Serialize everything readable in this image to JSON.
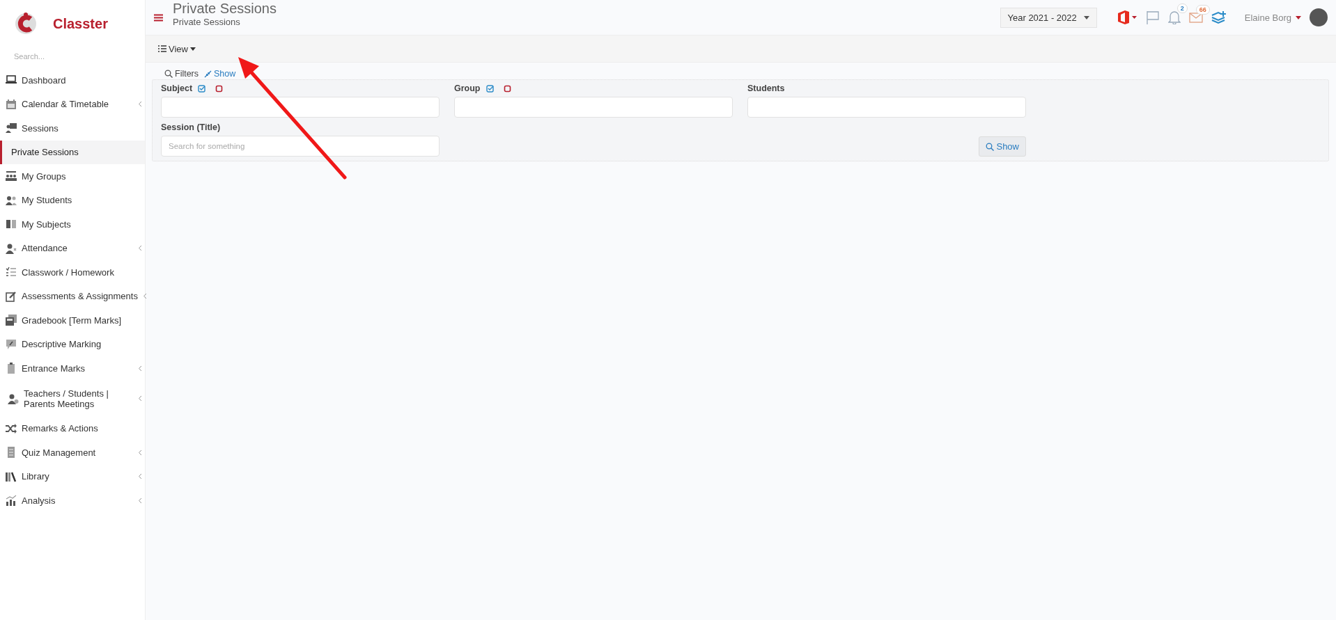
{
  "sidebar": {
    "brand": "Classter",
    "search": {
      "placeholder": "Search..."
    },
    "items": [
      {
        "label": "Dashboard",
        "has_submenu": false,
        "selected": false
      },
      {
        "label": "Calendar & Timetable",
        "has_submenu": true,
        "selected": false
      },
      {
        "label": "Sessions",
        "has_submenu": false,
        "selected": false,
        "children": [
          {
            "label": "Private Sessions",
            "selected": true
          }
        ]
      },
      {
        "label": "My Groups",
        "has_submenu": false,
        "selected": false
      },
      {
        "label": "My Students",
        "has_submenu": false,
        "selected": false
      },
      {
        "label": "My Subjects",
        "has_submenu": false,
        "selected": false
      },
      {
        "label": "Attendance",
        "has_submenu": true,
        "selected": false
      },
      {
        "label": "Classwork / Homework",
        "has_submenu": false,
        "selected": false
      },
      {
        "label": "Assessments & Assignments",
        "has_submenu": true,
        "selected": false
      },
      {
        "label": "Gradebook [Term Marks]",
        "has_submenu": false,
        "selected": false
      },
      {
        "label": "Descriptive Marking",
        "has_submenu": false,
        "selected": false
      },
      {
        "label": "Entrance Marks",
        "has_submenu": true,
        "selected": false
      },
      {
        "label": "Teachers / Students | Parents Meetings",
        "has_submenu": true,
        "selected": false
      },
      {
        "label": "Remarks & Actions",
        "has_submenu": false,
        "selected": false
      },
      {
        "label": "Quiz Management",
        "has_submenu": true,
        "selected": false
      },
      {
        "label": "Library",
        "has_submenu": true,
        "selected": false
      },
      {
        "label": "Analysis",
        "has_submenu": true,
        "selected": false
      }
    ]
  },
  "header": {
    "title": "Private Sessions",
    "breadcrumb": "Private Sessions",
    "year": "Year 2021 - 2022",
    "notifications": "2",
    "messages": "66",
    "user": "Elaine Borg"
  },
  "toolbar": {
    "view": "View"
  },
  "filters": {
    "label": "Filters",
    "toggle": "Show",
    "fields": [
      {
        "label": "Subject",
        "bulk_select": true
      },
      {
        "label": "Group",
        "bulk_select": true
      },
      {
        "label": "Students",
        "bulk_select": false
      },
      {
        "label": "Session (Title)",
        "bulk_select": false,
        "placeholder": "Search for something"
      }
    ],
    "button": "Show"
  }
}
